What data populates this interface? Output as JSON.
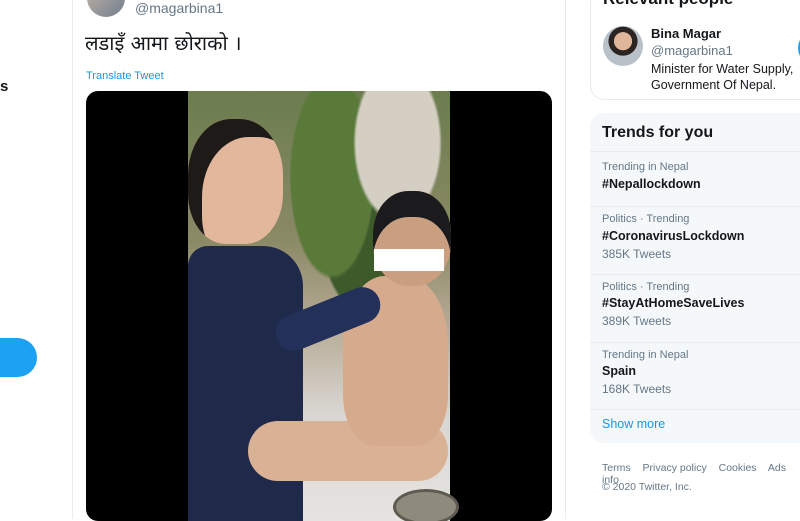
{
  "left_nav": {
    "partial_label": "s"
  },
  "tweet": {
    "handle": "@magarbina1",
    "text": "लडाइँ आमा छोराको ।",
    "translate_label": "Translate Tweet"
  },
  "relevant_people": {
    "title": "Relevant people",
    "person": {
      "name": "Bina Magar",
      "handle": "@magarbina1",
      "bio": "Minister for Water Supply, Government Of Nepal."
    }
  },
  "trends": {
    "title": "Trends for you",
    "items": [
      {
        "context": "Trending in Nepal",
        "name": "#Nepallockdown",
        "count": ""
      },
      {
        "context": "Politics · Trending",
        "name": "#CoronavirusLockdown",
        "count": "385K Tweets"
      },
      {
        "context": "Politics · Trending",
        "name": "#StayAtHomeSaveLives",
        "count": "389K Tweets"
      },
      {
        "context": "Trending in Nepal",
        "name": "Spain",
        "count": "168K Tweets"
      }
    ],
    "show_more": "Show more"
  },
  "footer": {
    "links": [
      "Terms",
      "Privacy policy",
      "Cookies",
      "Ads info"
    ],
    "copyright": "© 2020 Twitter, Inc."
  },
  "colors": {
    "accent": "#1da1f2",
    "link": "#1b95e0",
    "muted": "#657786"
  }
}
